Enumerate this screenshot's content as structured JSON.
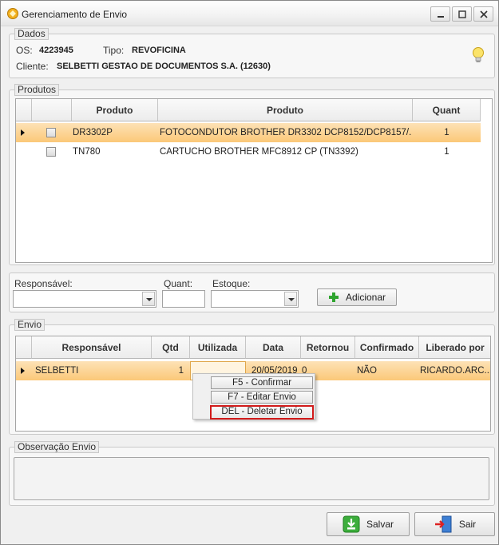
{
  "window": {
    "title": "Gerenciamento de Envio"
  },
  "dados": {
    "label": "Dados",
    "os_label": "OS:",
    "os_value": "4223945",
    "tipo_label": "Tipo:",
    "tipo_value": "REVOFICINA",
    "cliente_label": "Cliente:",
    "cliente_value": "SELBETTI GESTAO DE DOCUMENTOS S.A. (12630)"
  },
  "produtos": {
    "label": "Produtos",
    "headers": [
      "Produto",
      "Produto",
      "Quant"
    ],
    "rows": [
      {
        "code": "DR3302P",
        "desc": "FOTOCONDUTOR  BROTHER  DR3302  DCP8152/DCP8157/...",
        "qty": "1",
        "selected": true
      },
      {
        "code": "TN780",
        "desc": "CARTUCHO BROTHER MFC8912 CP (TN3392)",
        "qty": "1",
        "selected": false
      }
    ]
  },
  "form": {
    "responsavel_label": "Responsável:",
    "quant_label": "Quant:",
    "estoque_label": "Estoque:",
    "adicionar_label": "Adicionar"
  },
  "envio": {
    "label": "Envio",
    "headers": [
      "Responsável",
      "Qtd",
      "Utilizada",
      "Data",
      "Retornou",
      "Confirmado",
      "Liberado por"
    ],
    "rows": [
      {
        "responsavel": "SELBETTI",
        "qtd": "1",
        "utilizada": "",
        "data": "20/05/2019",
        "retornou": "0",
        "confirmado": "NÃO",
        "liberado": "RICARDO.ARC..."
      }
    ]
  },
  "context_menu": {
    "confirmar": "F5 - Confirmar",
    "editar": "F7 - Editar Envio",
    "deletar": "DEL - Deletar Envio"
  },
  "observacao": {
    "label": "Observação Envio",
    "value": ""
  },
  "footer": {
    "salvar_label": "Salvar",
    "sair_label": "Sair"
  },
  "colors": {
    "selection_top": "#fde2b6",
    "selection_bottom": "#fbc878",
    "highlight_border": "#d11a1a",
    "add_icon": "#2fa52f"
  }
}
